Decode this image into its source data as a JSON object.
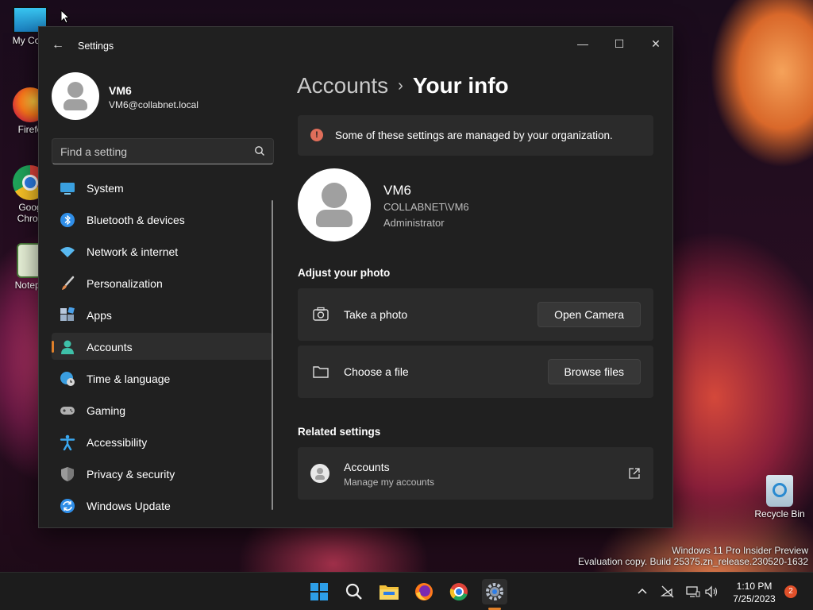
{
  "desktop": {
    "icons": [
      {
        "label": "My Com",
        "icon": "monitor-icon"
      },
      {
        "label": "Firefo",
        "icon": "firefox-icon"
      },
      {
        "label": "Goog",
        "label2": "Chron",
        "icon": "chrome-icon"
      },
      {
        "label": "Notepa",
        "icon": "notepad-icon"
      },
      {
        "label": "Recycle Bin",
        "icon": "recycle-bin-icon"
      }
    ],
    "watermark_line1": "Windows 11 Pro Insider Preview",
    "watermark_line2": "Evaluation copy. Build 25375.zn_release.230520-1632"
  },
  "window": {
    "title": "Settings",
    "back_icon": "back-arrow-icon",
    "controls": {
      "minimize": "—",
      "maximize": "☐",
      "close": "✕"
    }
  },
  "profile": {
    "name": "VM6",
    "email": "VM6@collabnet.local"
  },
  "search": {
    "placeholder": "Find a setting",
    "icon": "search-icon"
  },
  "nav": [
    {
      "label": "System",
      "icon": "system-icon",
      "color": "#3aa0e0"
    },
    {
      "label": "Bluetooth & devices",
      "icon": "bluetooth-icon",
      "color": "#2f8ee8"
    },
    {
      "label": "Network & internet",
      "icon": "wifi-icon",
      "color": "#58b8f0"
    },
    {
      "label": "Personalization",
      "icon": "brush-icon",
      "color": "#e08a50"
    },
    {
      "label": "Apps",
      "icon": "apps-icon",
      "color": "#9fb4cc"
    },
    {
      "label": "Accounts",
      "icon": "accounts-icon",
      "color": "#3ec0a8",
      "active": true
    },
    {
      "label": "Time & language",
      "icon": "globe-clock-icon",
      "color": "#3a9ee0"
    },
    {
      "label": "Gaming",
      "icon": "gamepad-icon",
      "color": "#b0b0b0"
    },
    {
      "label": "Accessibility",
      "icon": "accessibility-icon",
      "color": "#3aa8f0"
    },
    {
      "label": "Privacy & security",
      "icon": "shield-icon",
      "color": "#9a9a9a"
    },
    {
      "label": "Windows Update",
      "icon": "update-icon",
      "color": "#2f8ee8"
    }
  ],
  "main": {
    "breadcrumb_parent": "Accounts",
    "breadcrumb_sep": "›",
    "breadcrumb_current": "Your info",
    "banner": {
      "icon": "info-alert-icon",
      "glyph": "!",
      "text": "Some of these settings are managed by your organization."
    },
    "user": {
      "name": "VM6",
      "domain": "COLLABNET\\VM6",
      "role": "Administrator"
    },
    "adjust_photo_title": "Adjust your photo",
    "take_photo": {
      "label": "Take a photo",
      "button": "Open Camera",
      "icon": "camera-icon"
    },
    "choose_file": {
      "label": "Choose a file",
      "button": "Browse files",
      "icon": "folder-icon"
    },
    "related_title": "Related settings",
    "related_accounts": {
      "label": "Accounts",
      "sub": "Manage my accounts",
      "icon": "external-link-icon"
    }
  },
  "taskbar": {
    "apps": [
      "start-icon",
      "search-icon",
      "file-explorer-icon",
      "firefox-icon",
      "chrome-icon",
      "settings-icon"
    ],
    "tray": [
      "chevron-up-icon",
      "network-disconnected-icon",
      "display-icon",
      "volume-icon"
    ],
    "time": "1:10 PM",
    "date": "7/25/2023",
    "notification_count": "2"
  }
}
